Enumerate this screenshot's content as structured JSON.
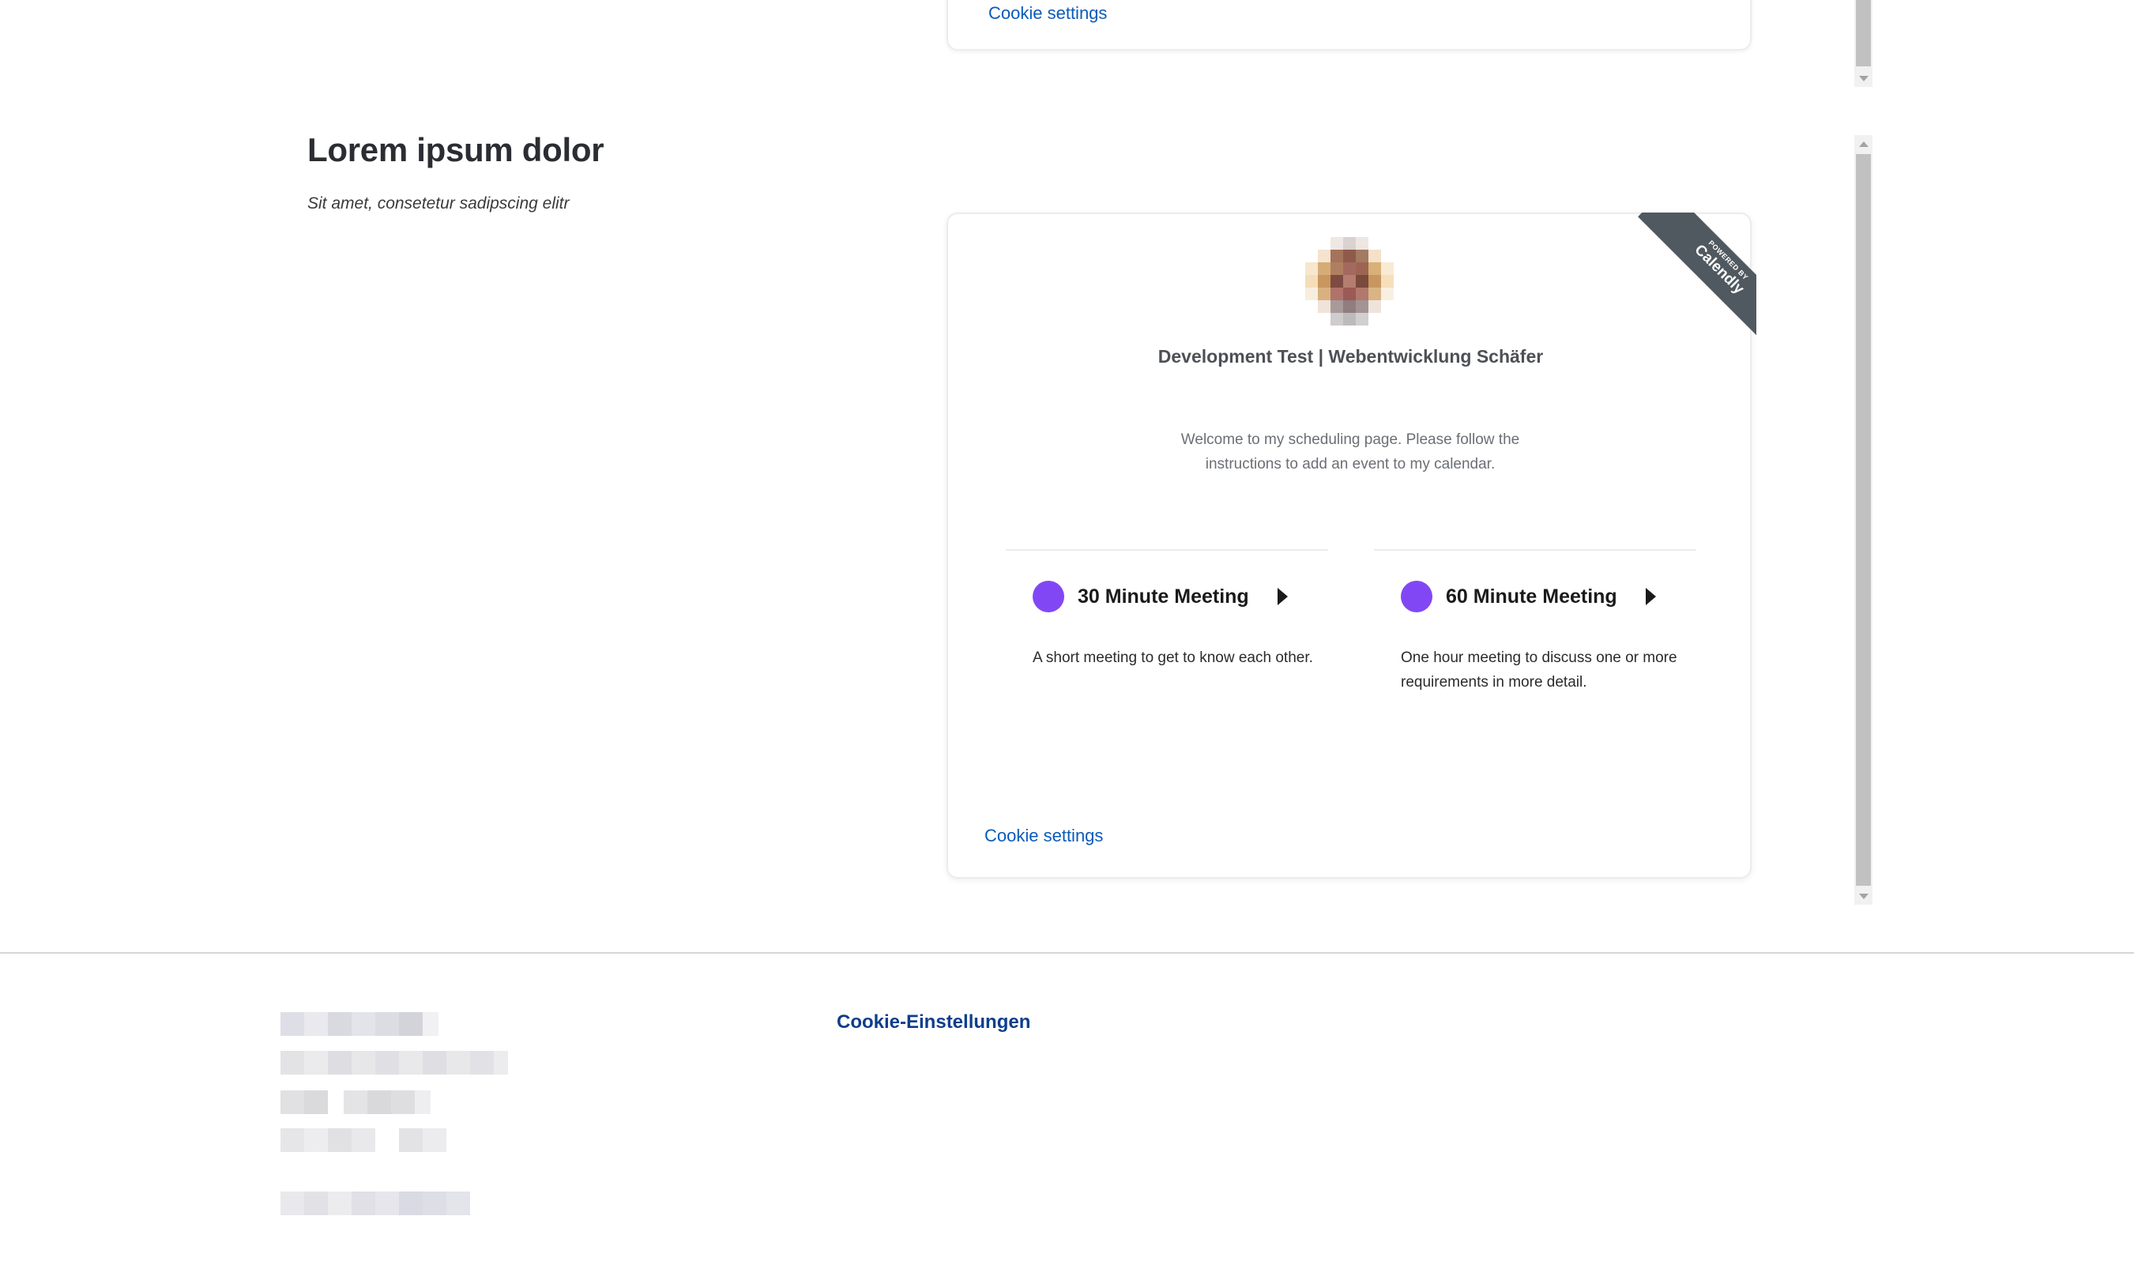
{
  "top_embed": {
    "cookie_link": "Cookie settings"
  },
  "section": {
    "title": "Lorem ipsum dolor",
    "subtitle": "Sit amet, consetetur sadipscing elitr"
  },
  "scheduler": {
    "ribbon_small": "POWERED BY",
    "ribbon_brand": "Calendly",
    "ribbon_color": "#505960",
    "org_name": "Development Test | Webentwicklung Schäfer",
    "welcome": "Welcome to my scheduling page. Please follow the instructions to add an event to my calendar.",
    "events": [
      {
        "title": "30 Minute Meeting",
        "description": "A short meeting to get to know each other.",
        "color": "#8247f5"
      },
      {
        "title": "60 Minute Meeting",
        "description": "One hour meeting to discuss one or more requirements in more detail.",
        "color": "#8247f5"
      }
    ],
    "cookie_link": "Cookie settings"
  },
  "footer": {
    "cookie_link": "Cookie-Einstellungen",
    "link_color": "#0d3e8c"
  },
  "colors": {
    "accent_purple": "#8247f5",
    "link_blue": "#0b5ab9"
  }
}
